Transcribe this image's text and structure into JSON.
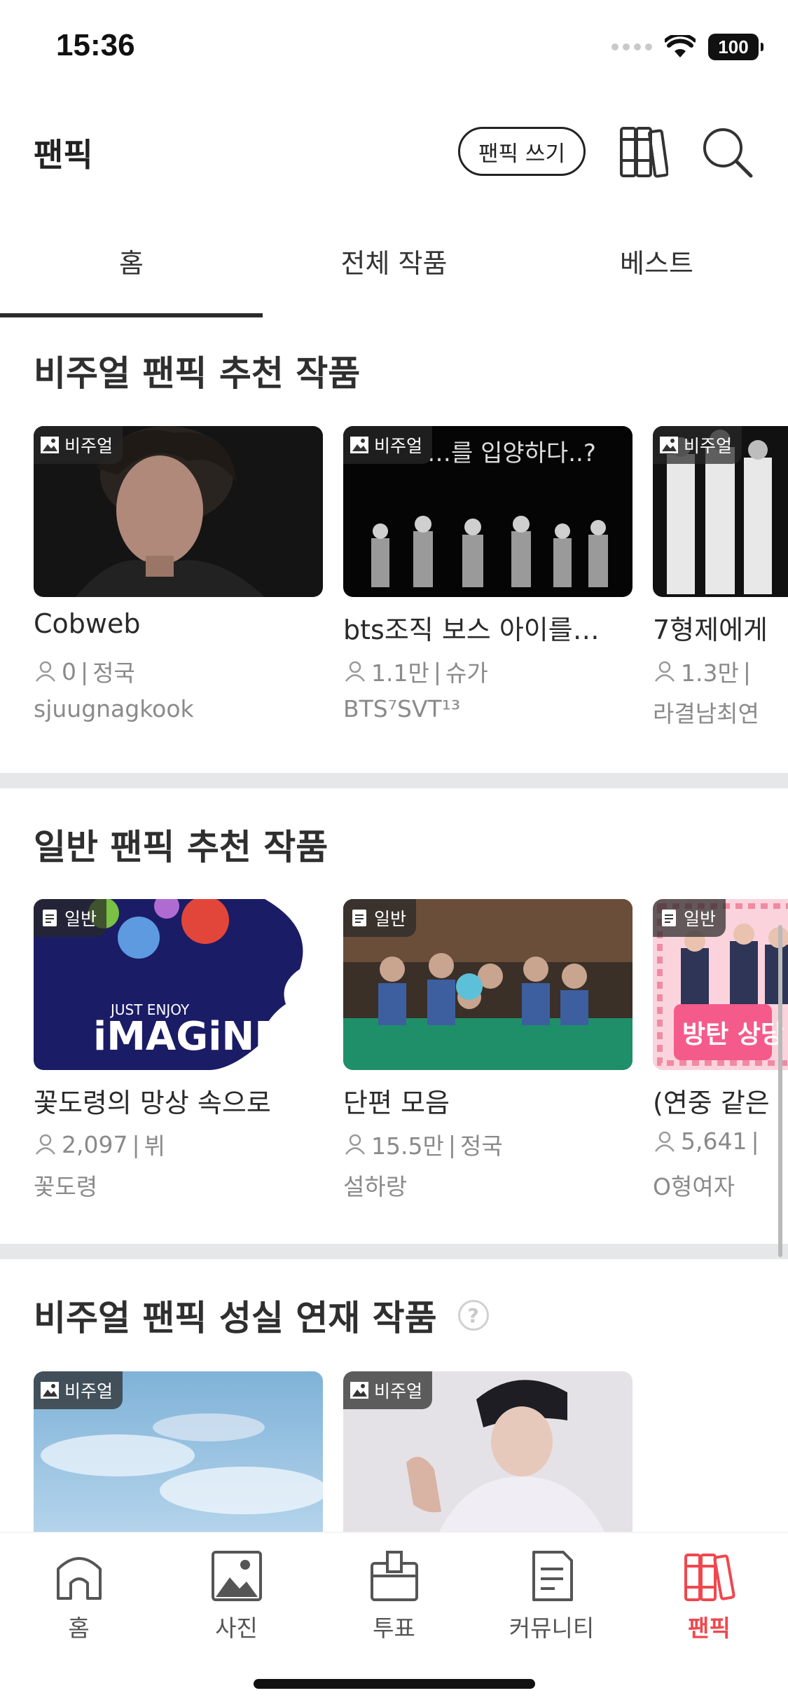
{
  "status_bar": {
    "time": "15:36",
    "battery": "100"
  },
  "header": {
    "title": "팬픽",
    "write_label": "팬픽 쓰기"
  },
  "tabs": [
    {
      "label": "홈",
      "active": true
    },
    {
      "label": "전체 작품",
      "active": false
    },
    {
      "label": "베스트",
      "active": false
    }
  ],
  "sections": [
    {
      "title": "비주얼 팬픽 추천 작품",
      "cards": [
        {
          "badge": "비주얼",
          "title": "Cobweb",
          "views": "0",
          "tag": "정국",
          "author": "sjuugnagkook"
        },
        {
          "badge": "비주얼",
          "title": "bts조직 보스 아이를…",
          "views": "1.1만",
          "tag": "슈가",
          "author": "BTS⁷SVT¹³"
        },
        {
          "badge": "비주얼",
          "title": "7형제에게",
          "views": "1.3만",
          "tag": "",
          "author": "라결남최연"
        }
      ]
    },
    {
      "title": "일반 팬픽 추천 작품",
      "cards": [
        {
          "badge": "일반",
          "title": "꽃도령의 망상 속으로",
          "views": "2,097",
          "tag": "뷔",
          "author": "꽃도령"
        },
        {
          "badge": "일반",
          "title": "단편 모음",
          "views": "15.5만",
          "tag": "정국",
          "author": "설하랑"
        },
        {
          "badge": "일반",
          "title": "(연중 같은",
          "views": "5,641",
          "tag": "",
          "author": "O형여자"
        }
      ]
    },
    {
      "title": "비주얼 팬픽 성실 연재 작품",
      "help": "?",
      "cards": [
        {
          "badge": "비주얼"
        },
        {
          "badge": "비주얼"
        }
      ]
    }
  ],
  "thumb_text": {
    "imagine_small": "JUST ENJOY",
    "imagine_big": "iMAGiNE",
    "bts_caption": "…를 입양하다..?",
    "pink_caption": "방탄 상당"
  },
  "bottom_nav": [
    {
      "label": "홈",
      "icon": "home-icon"
    },
    {
      "label": "사진",
      "icon": "photo-icon"
    },
    {
      "label": "투표",
      "icon": "vote-icon"
    },
    {
      "label": "커뮤니티",
      "icon": "community-icon"
    },
    {
      "label": "팬픽",
      "icon": "fanfic-icon",
      "active": true
    }
  ],
  "colors": {
    "accent": "#f0474e",
    "text": "#2b2b2b",
    "muted": "#8a8a8a",
    "divider": "#e6e7e9"
  }
}
